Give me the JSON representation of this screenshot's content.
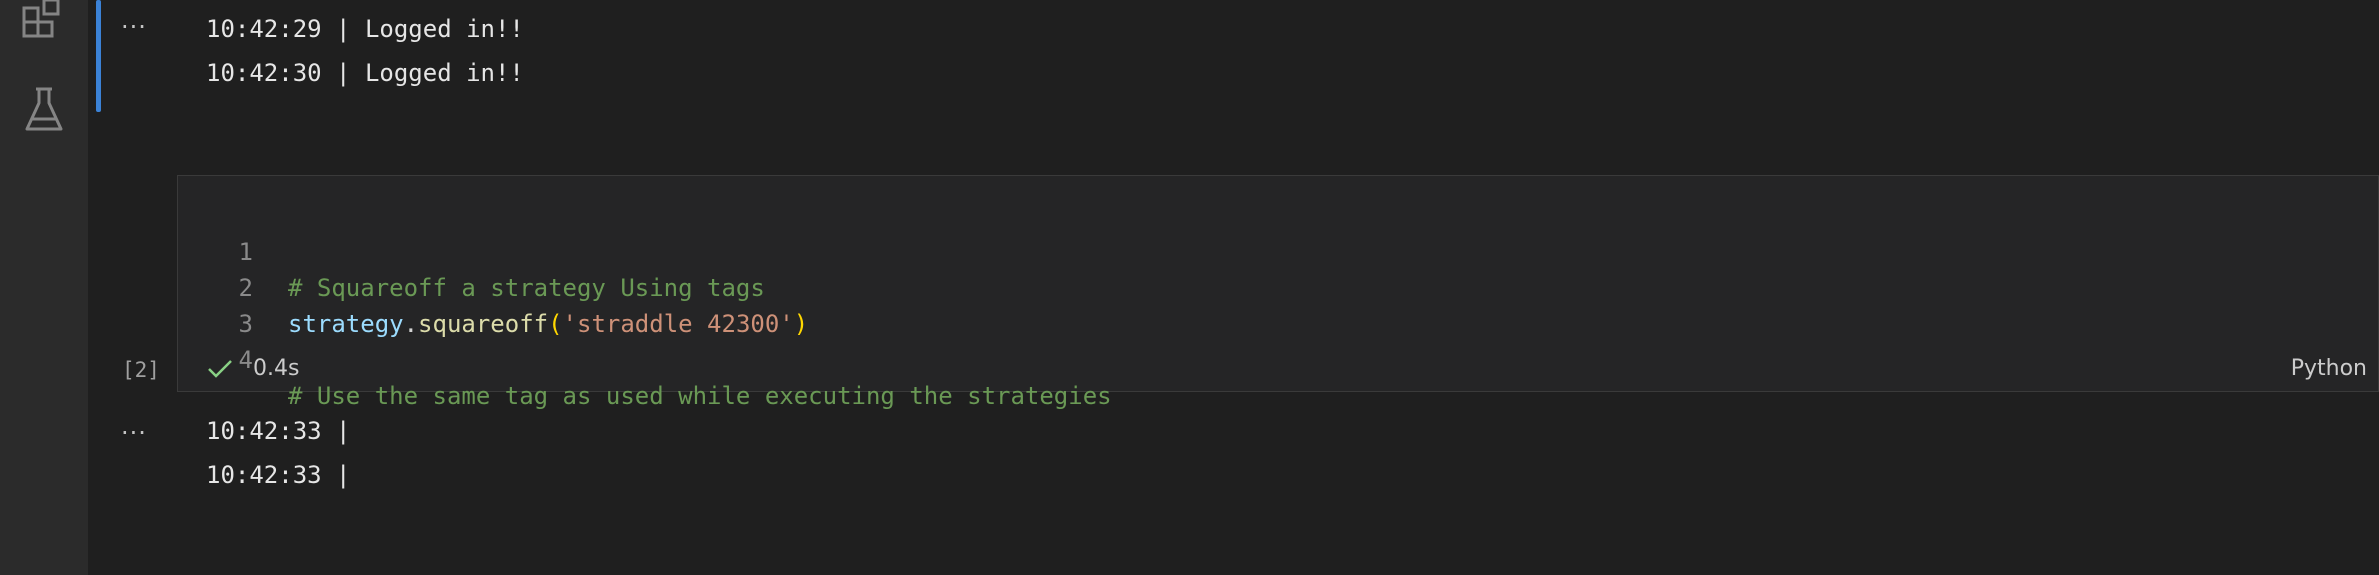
{
  "outputs_top": {
    "lines": [
      "10:42:29 | Logged in!!",
      "10:42:30 | Logged in!!"
    ]
  },
  "cell": {
    "execution_count": "[2]",
    "duration": "0.4s",
    "language": "Python",
    "lines": [
      {
        "number": "1",
        "comment": "# Squareoff a strategy Using tags"
      },
      {
        "number": "2",
        "var": "strategy",
        "dot": ".",
        "fn": "squareoff",
        "open": "(",
        "str": "'straddle 42300'",
        "close": ")"
      },
      {
        "number": "3"
      },
      {
        "number": "4",
        "comment": "# Use the same tag as used while executing the strategies"
      }
    ]
  },
  "outputs_bottom": {
    "lines": [
      "10:42:33 |",
      "10:42:33 |"
    ]
  },
  "icons": {
    "extensions": "extensions-icon",
    "testing": "beaker-icon",
    "success": "check-icon",
    "more": "more-icon"
  },
  "colors": {
    "accent": "#3b82d6",
    "success": "#89d185"
  }
}
